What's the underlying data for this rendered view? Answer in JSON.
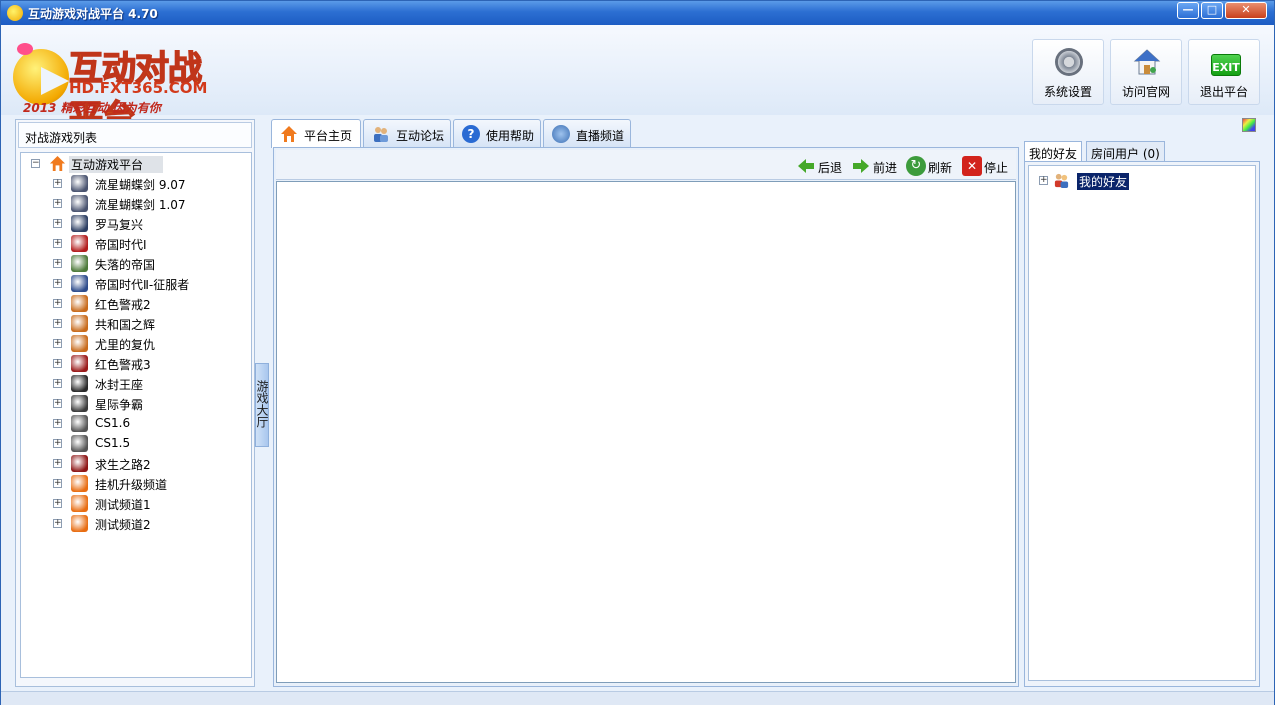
{
  "window": {
    "title": "互动游戏对战平台 4.70",
    "controls": {
      "minimize": "—",
      "maximize": "□",
      "close": "✕"
    }
  },
  "logo": {
    "title": "互动对战平台",
    "url": "HD.FXT365.COM",
    "slogan": "2013 精彩互动 因为有你"
  },
  "toolbar": {
    "settings_label": "系统设置",
    "website_label": "访问官网",
    "exit_label": "退出平台",
    "exit_icon_text": "EXIT"
  },
  "left_panel": {
    "header": "对战游戏列表",
    "root": {
      "label": "互动游戏平台",
      "expander": "−"
    },
    "items": [
      {
        "label": "流星蝴蝶剑 9.07",
        "icon": "butterfly-sword-icon",
        "color": "#4a5470"
      },
      {
        "label": "流星蝴蝶剑 1.07",
        "icon": "butterfly-sword-icon",
        "color": "#4a5470"
      },
      {
        "label": "罗马复兴",
        "icon": "rome-icon",
        "color": "#2d3f63"
      },
      {
        "label": "帝国时代Ⅰ",
        "icon": "age-of-empires-icon",
        "color": "#b31d1d"
      },
      {
        "label": "失落的帝国",
        "icon": "lost-empire-icon",
        "color": "#4d7a3a"
      },
      {
        "label": "帝国时代Ⅱ-征服者",
        "icon": "conquerors-icon",
        "color": "#2e4c8c"
      },
      {
        "label": "红色警戒2",
        "icon": "red-alert-icon",
        "color": "#c86b1c"
      },
      {
        "label": "共和国之辉",
        "icon": "red-alert-icon",
        "color": "#c86b1c"
      },
      {
        "label": "尤里的复仇",
        "icon": "red-alert-icon",
        "color": "#c86b1c"
      },
      {
        "label": "红色警戒3",
        "icon": "red-alert-3-icon",
        "color": "#9a1a1a"
      },
      {
        "label": "冰封王座",
        "icon": "frozen-throne-icon",
        "color": "#2a2a2a"
      },
      {
        "label": "星际争霸",
        "icon": "starcraft-icon",
        "color": "#3b3b3b"
      },
      {
        "label": "CS1.6",
        "icon": "counter-strike-icon",
        "color": "#555555"
      },
      {
        "label": "CS1.5",
        "icon": "counter-strike-icon",
        "color": "#555555"
      },
      {
        "label": "求生之路2",
        "icon": "left4dead-icon",
        "color": "#8e1616"
      },
      {
        "label": "挂机升级频道",
        "icon": "home-icon",
        "color": "#e86d12"
      },
      {
        "label": "测试频道1",
        "icon": "home-icon",
        "color": "#e86d12"
      },
      {
        "label": "测试频道2",
        "icon": "home-icon",
        "color": "#e86d12"
      }
    ],
    "expander": "+"
  },
  "side_tab": {
    "label": "游戏大厅"
  },
  "center": {
    "tabs": [
      {
        "label": "平台主页",
        "icon": "home-icon"
      },
      {
        "label": "互动论坛",
        "icon": "users-icon"
      },
      {
        "label": "使用帮助",
        "icon": "help-icon"
      },
      {
        "label": "直播频道",
        "icon": "broadcast-icon"
      }
    ],
    "nav": {
      "back": "后退",
      "forward": "前进",
      "refresh": "刷新",
      "stop": "停止"
    }
  },
  "right_panel": {
    "tabs": [
      {
        "label": "我的好友"
      },
      {
        "label": "房间用户 (0)"
      }
    ],
    "friend_root": {
      "label": "我的好友",
      "expander": "+"
    }
  },
  "colors": {
    "titlebar": "#2c6fd2",
    "accent": "#0a246a",
    "panel_bg": "#e9f1fb"
  }
}
